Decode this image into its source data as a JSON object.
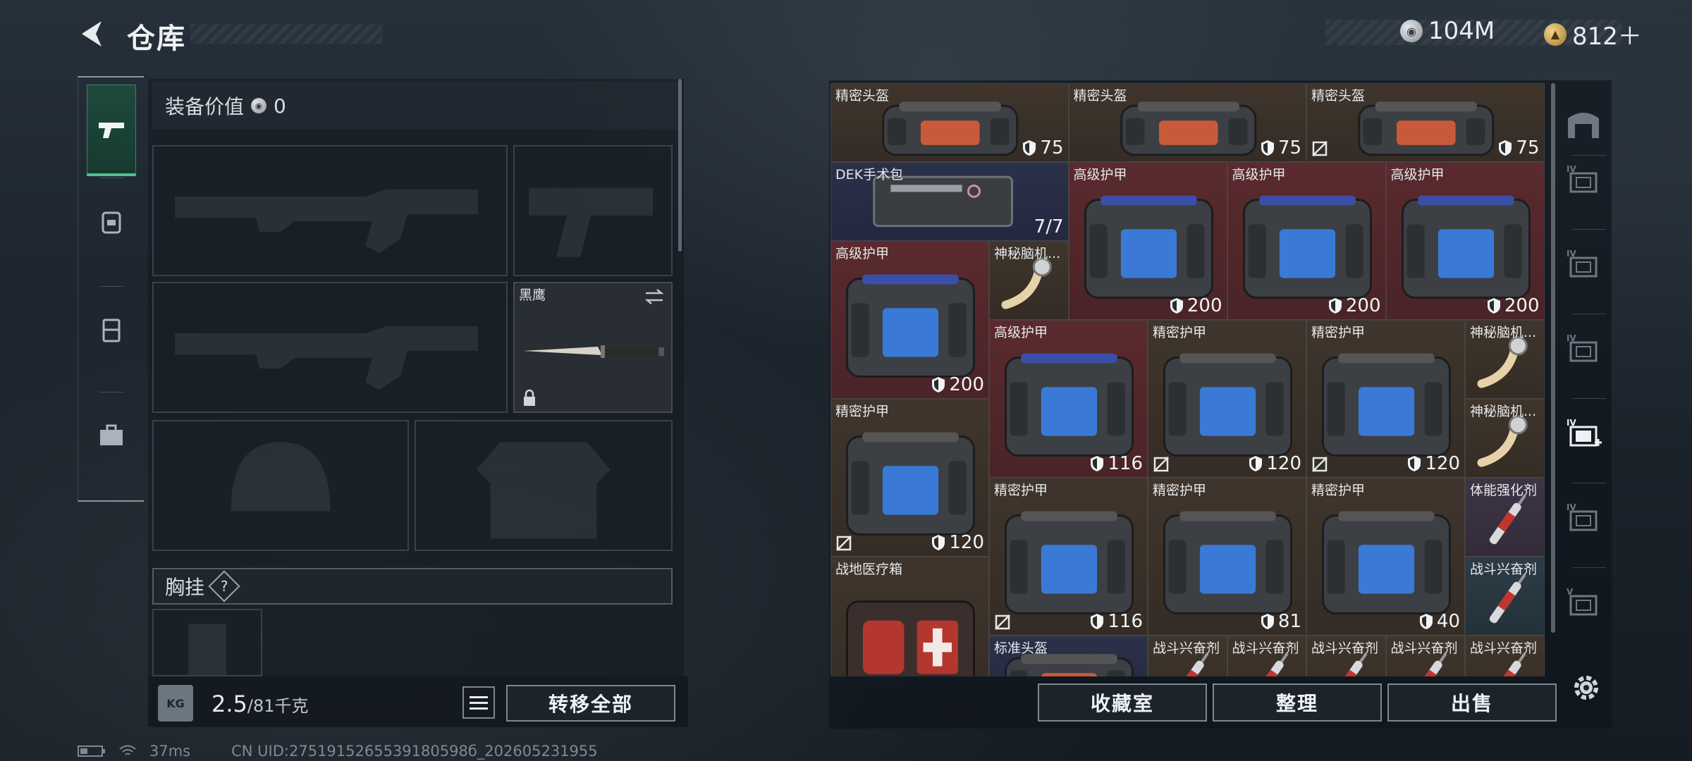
{
  "header": {
    "title": "仓库",
    "currencies": [
      {
        "icon": "silver-coin-icon",
        "value": "104M"
      },
      {
        "icon": "gold-coin-icon",
        "value": "812＋"
      }
    ]
  },
  "equipment": {
    "value_label": "装备价值",
    "value": "0",
    "knife_name": "黑鹰",
    "chest_label": "胸挂",
    "help": "?"
  },
  "capacity": {
    "current": "2.5",
    "max": "/81千克",
    "kg_icon": "KG"
  },
  "buttons": {
    "transfer_all": "转移全部",
    "collection": "收藏室",
    "organize": "整理",
    "sell": "出售"
  },
  "status": {
    "ping": "37ms",
    "uid": "CN UID:2751915265539180598б_202605231955"
  },
  "items": [
    {
      "name": "精密头盔",
      "value": "75",
      "kind": "helmet",
      "bg": "brown"
    },
    {
      "name": "精密头盔",
      "value": "75",
      "kind": "helmet",
      "bg": "brown"
    },
    {
      "name": "精密头盔",
      "value": "75",
      "kind": "helmet",
      "bg": "brown",
      "noin": true
    },
    {
      "name": "DEK手术包",
      "value": "7/7",
      "kind": "medkit",
      "bg": "blue"
    },
    {
      "name": "高级护甲",
      "value": "200",
      "kind": "armor",
      "bg": "red"
    },
    {
      "name": "高级护甲",
      "value": "200",
      "kind": "armor",
      "bg": "red"
    },
    {
      "name": "高级护甲",
      "value": "200",
      "kind": "armor",
      "bg": "red"
    },
    {
      "name": "高级护甲",
      "value": "200",
      "kind": "armor",
      "bg": "red"
    },
    {
      "name": "神秘脑机...",
      "value": "",
      "kind": "chip",
      "bg": "brown"
    },
    {
      "name": "高级护甲",
      "value": "116",
      "kind": "armor",
      "bg": "red"
    },
    {
      "name": "精密护甲",
      "value": "120",
      "kind": "armor2",
      "bg": "brown",
      "noin": true
    },
    {
      "name": "精密护甲",
      "value": "120",
      "kind": "armor2",
      "bg": "brown",
      "noin": true
    },
    {
      "name": "神秘脑机...",
      "value": "",
      "kind": "chip",
      "bg": "brown"
    },
    {
      "name": "精密护甲",
      "value": "120",
      "kind": "armor2",
      "bg": "brown",
      "noin": true
    },
    {
      "name": "神秘脑机...",
      "value": "",
      "kind": "chip",
      "bg": "brown"
    },
    {
      "name": "精密护甲",
      "value": "116",
      "kind": "armor2",
      "bg": "brown",
      "noin": true
    },
    {
      "name": "精密护甲",
      "value": "81",
      "kind": "armor2",
      "bg": "brown"
    },
    {
      "name": "精密护甲",
      "value": "40",
      "kind": "armor2",
      "bg": "brown"
    },
    {
      "name": "体能强化剂",
      "value": "",
      "kind": "syringe",
      "bg": "purple"
    },
    {
      "name": "战地医疗箱",
      "value": "",
      "kind": "firstaid",
      "bg": "brown"
    },
    {
      "name": "战斗兴奋剂",
      "value": "",
      "kind": "syringe",
      "bg": "teal"
    },
    {
      "name": "标准头盔",
      "value": "",
      "kind": "helmet",
      "bg": "blue"
    },
    {
      "name": "战斗兴奋剂",
      "value": "",
      "kind": "syringe",
      "bg": "brown"
    },
    {
      "name": "战斗兴奋剂",
      "value": "",
      "kind": "syringe",
      "bg": "brown"
    },
    {
      "name": "战斗兴奋剂",
      "value": "",
      "kind": "syringe",
      "bg": "brown"
    },
    {
      "name": "战斗兴奋剂",
      "value": "",
      "kind": "syringe",
      "bg": "brown"
    },
    {
      "name": "战斗兴奋剂",
      "value": "",
      "kind": "syringe",
      "bg": "brown"
    }
  ],
  "side_tabs": [
    "home-icon",
    "storage-iv-icon",
    "storage-iv-icon",
    "storage-iv-icon",
    "storage-iv-add-icon",
    "storage-iv-icon",
    "storage-v-icon"
  ],
  "colors": {
    "accent": "#47c78f",
    "armor_bg": "#4a2427",
    "helmet_bg": "#342c25",
    "blue_bg": "#232840"
  }
}
